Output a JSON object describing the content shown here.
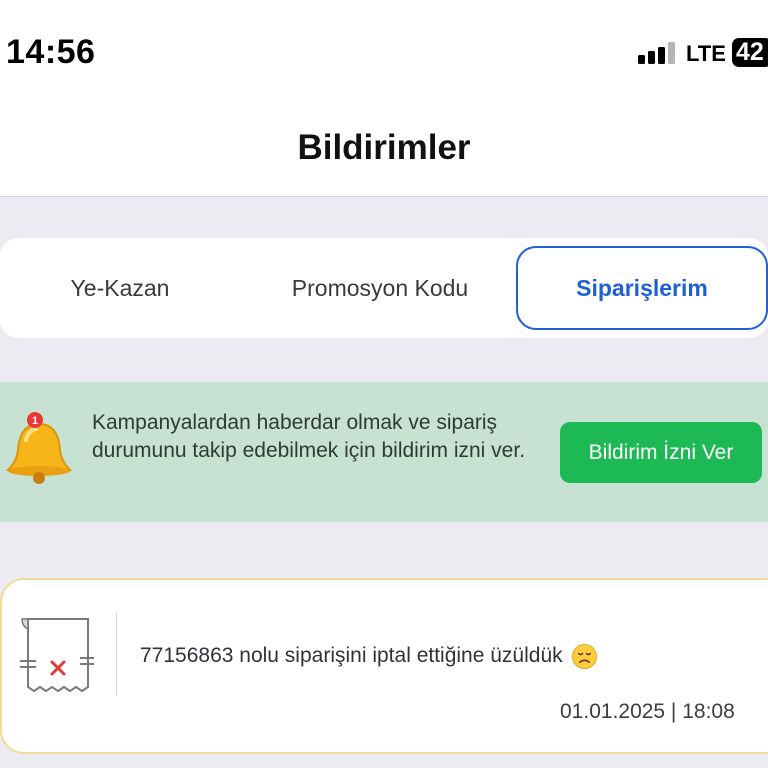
{
  "status_bar": {
    "time": "14:56",
    "network": "LTE",
    "battery": "42"
  },
  "header": {
    "title": "Bildirimler"
  },
  "tabs": [
    {
      "label": "Ye-Kazan",
      "active": false
    },
    {
      "label": "Promosyon Kodu",
      "active": false
    },
    {
      "label": "Siparişlerim",
      "active": true
    }
  ],
  "permission_banner": {
    "message": "Kampanyalardan haberdar olmak ve sipariş durumunu takip edebilmek için bildirim izni ver.",
    "badge_count": "1",
    "button_label": "Bildirim İzni Ver"
  },
  "notifications": [
    {
      "message": "77156863 nolu siparişini iptal ettiğine üzüldük",
      "emoji": "disappointed-face-icon",
      "timestamp": "01.01.2025 | 18:08"
    }
  ],
  "colors": {
    "accent_blue": "#1f5fd6",
    "banner_green": "#c7e2d3",
    "button_green": "#1db954",
    "card_border": "#f0dc97"
  }
}
